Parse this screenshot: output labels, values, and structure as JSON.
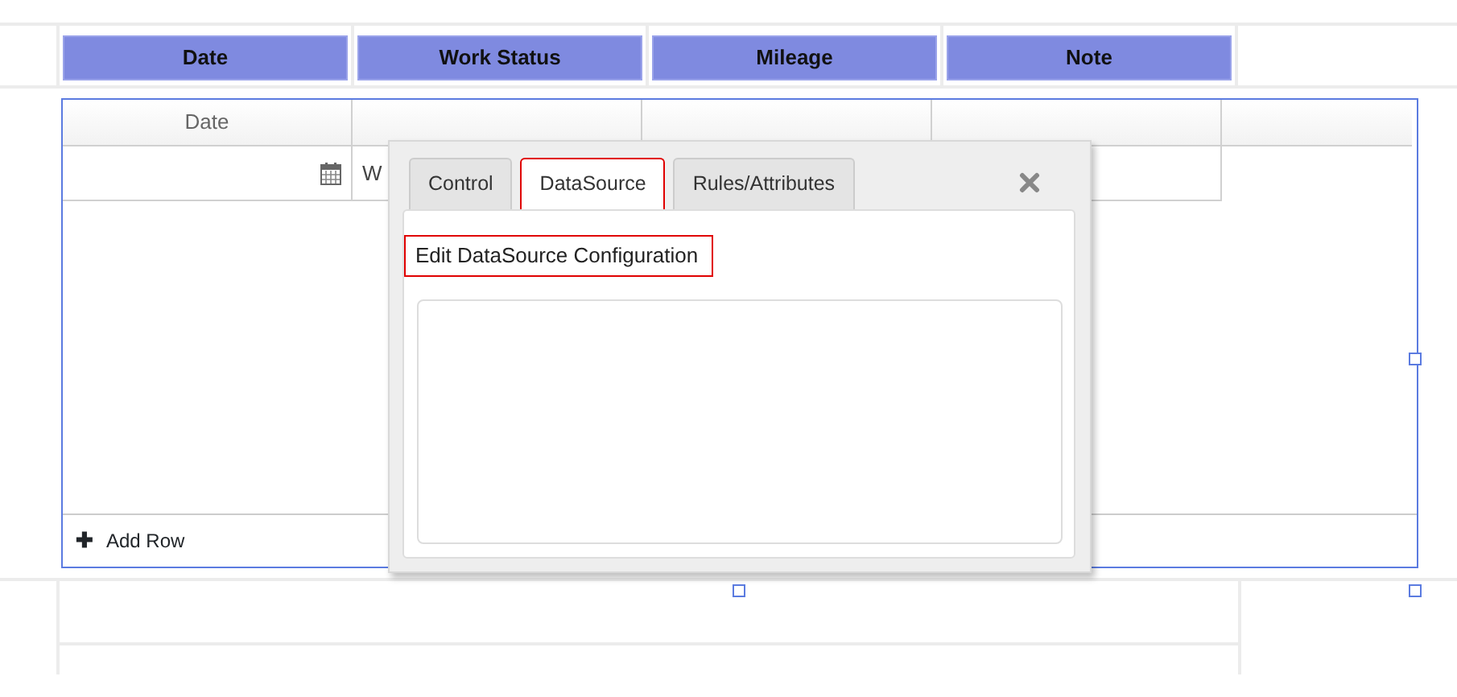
{
  "form_header": {
    "columns": [
      {
        "label": "Date"
      },
      {
        "label": "Work Status"
      },
      {
        "label": "Mileage"
      },
      {
        "label": "Note"
      }
    ]
  },
  "grid": {
    "header_label": "Date",
    "first_row_visible_text": "W",
    "add_row": {
      "icon": "✚",
      "label": "Add Row"
    }
  },
  "dialog": {
    "tabs": [
      {
        "label": "Control",
        "selected": false
      },
      {
        "label": "DataSource",
        "selected": true
      },
      {
        "label": "Rules/Attributes",
        "selected": false
      }
    ],
    "heading": "Edit DataSource Configuration"
  }
}
